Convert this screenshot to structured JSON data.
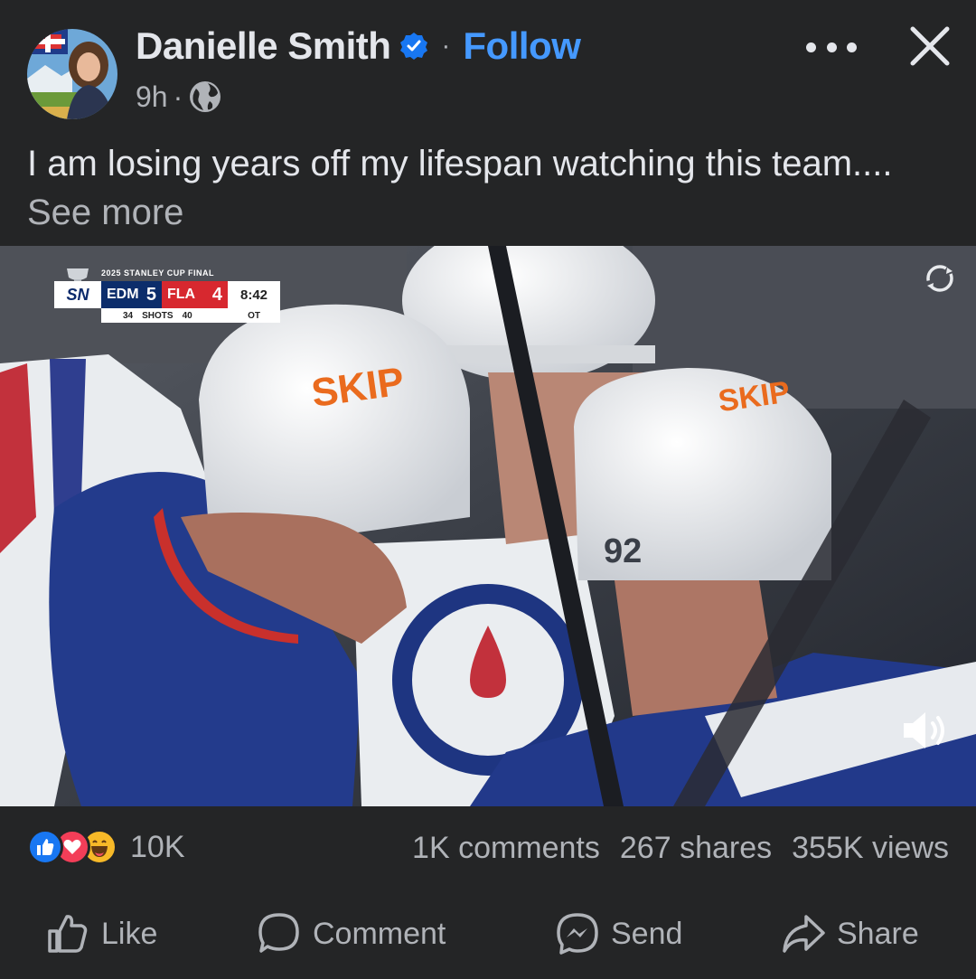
{
  "post": {
    "author": "Danielle Smith",
    "follow_label": "Follow",
    "separator": "·",
    "time": "9h",
    "time_sep": "·",
    "text": "I am losing years off my lifespan watching this team.... ",
    "see_more": "See more"
  },
  "video": {
    "scorebug": {
      "title": "2025 STANLEY CUP FINAL",
      "network": "SN",
      "team1": "EDM",
      "score1": "5",
      "team2": "FLA",
      "score2": "4",
      "clock": "8:42",
      "shots1": "34",
      "shots_label": "SHOTS",
      "shots2": "40",
      "period": "OT"
    },
    "helmet_text": "SKIP",
    "jersey_number": "92"
  },
  "stats": {
    "reactions_count": "10K",
    "comments": "1K comments",
    "shares": "267 shares",
    "views": "355K views"
  },
  "actions": {
    "like": "Like",
    "comment": "Comment",
    "send": "Send",
    "share": "Share"
  },
  "colors": {
    "background": "#242526",
    "text_primary": "#e4e6eb",
    "text_secondary": "#b0b3b8",
    "link_blue": "#4599ff",
    "like_blue": "#1877f2",
    "love_red": "#f33e58",
    "haha_yellow": "#f7b928"
  },
  "icons": [
    "verified-badge-icon",
    "globe-icon",
    "more-options-icon",
    "close-icon",
    "reload-icon",
    "volume-icon",
    "like-reaction-icon",
    "love-reaction-icon",
    "haha-reaction-icon",
    "thumbs-up-icon",
    "comment-bubble-icon",
    "messenger-icon",
    "share-arrow-icon"
  ]
}
